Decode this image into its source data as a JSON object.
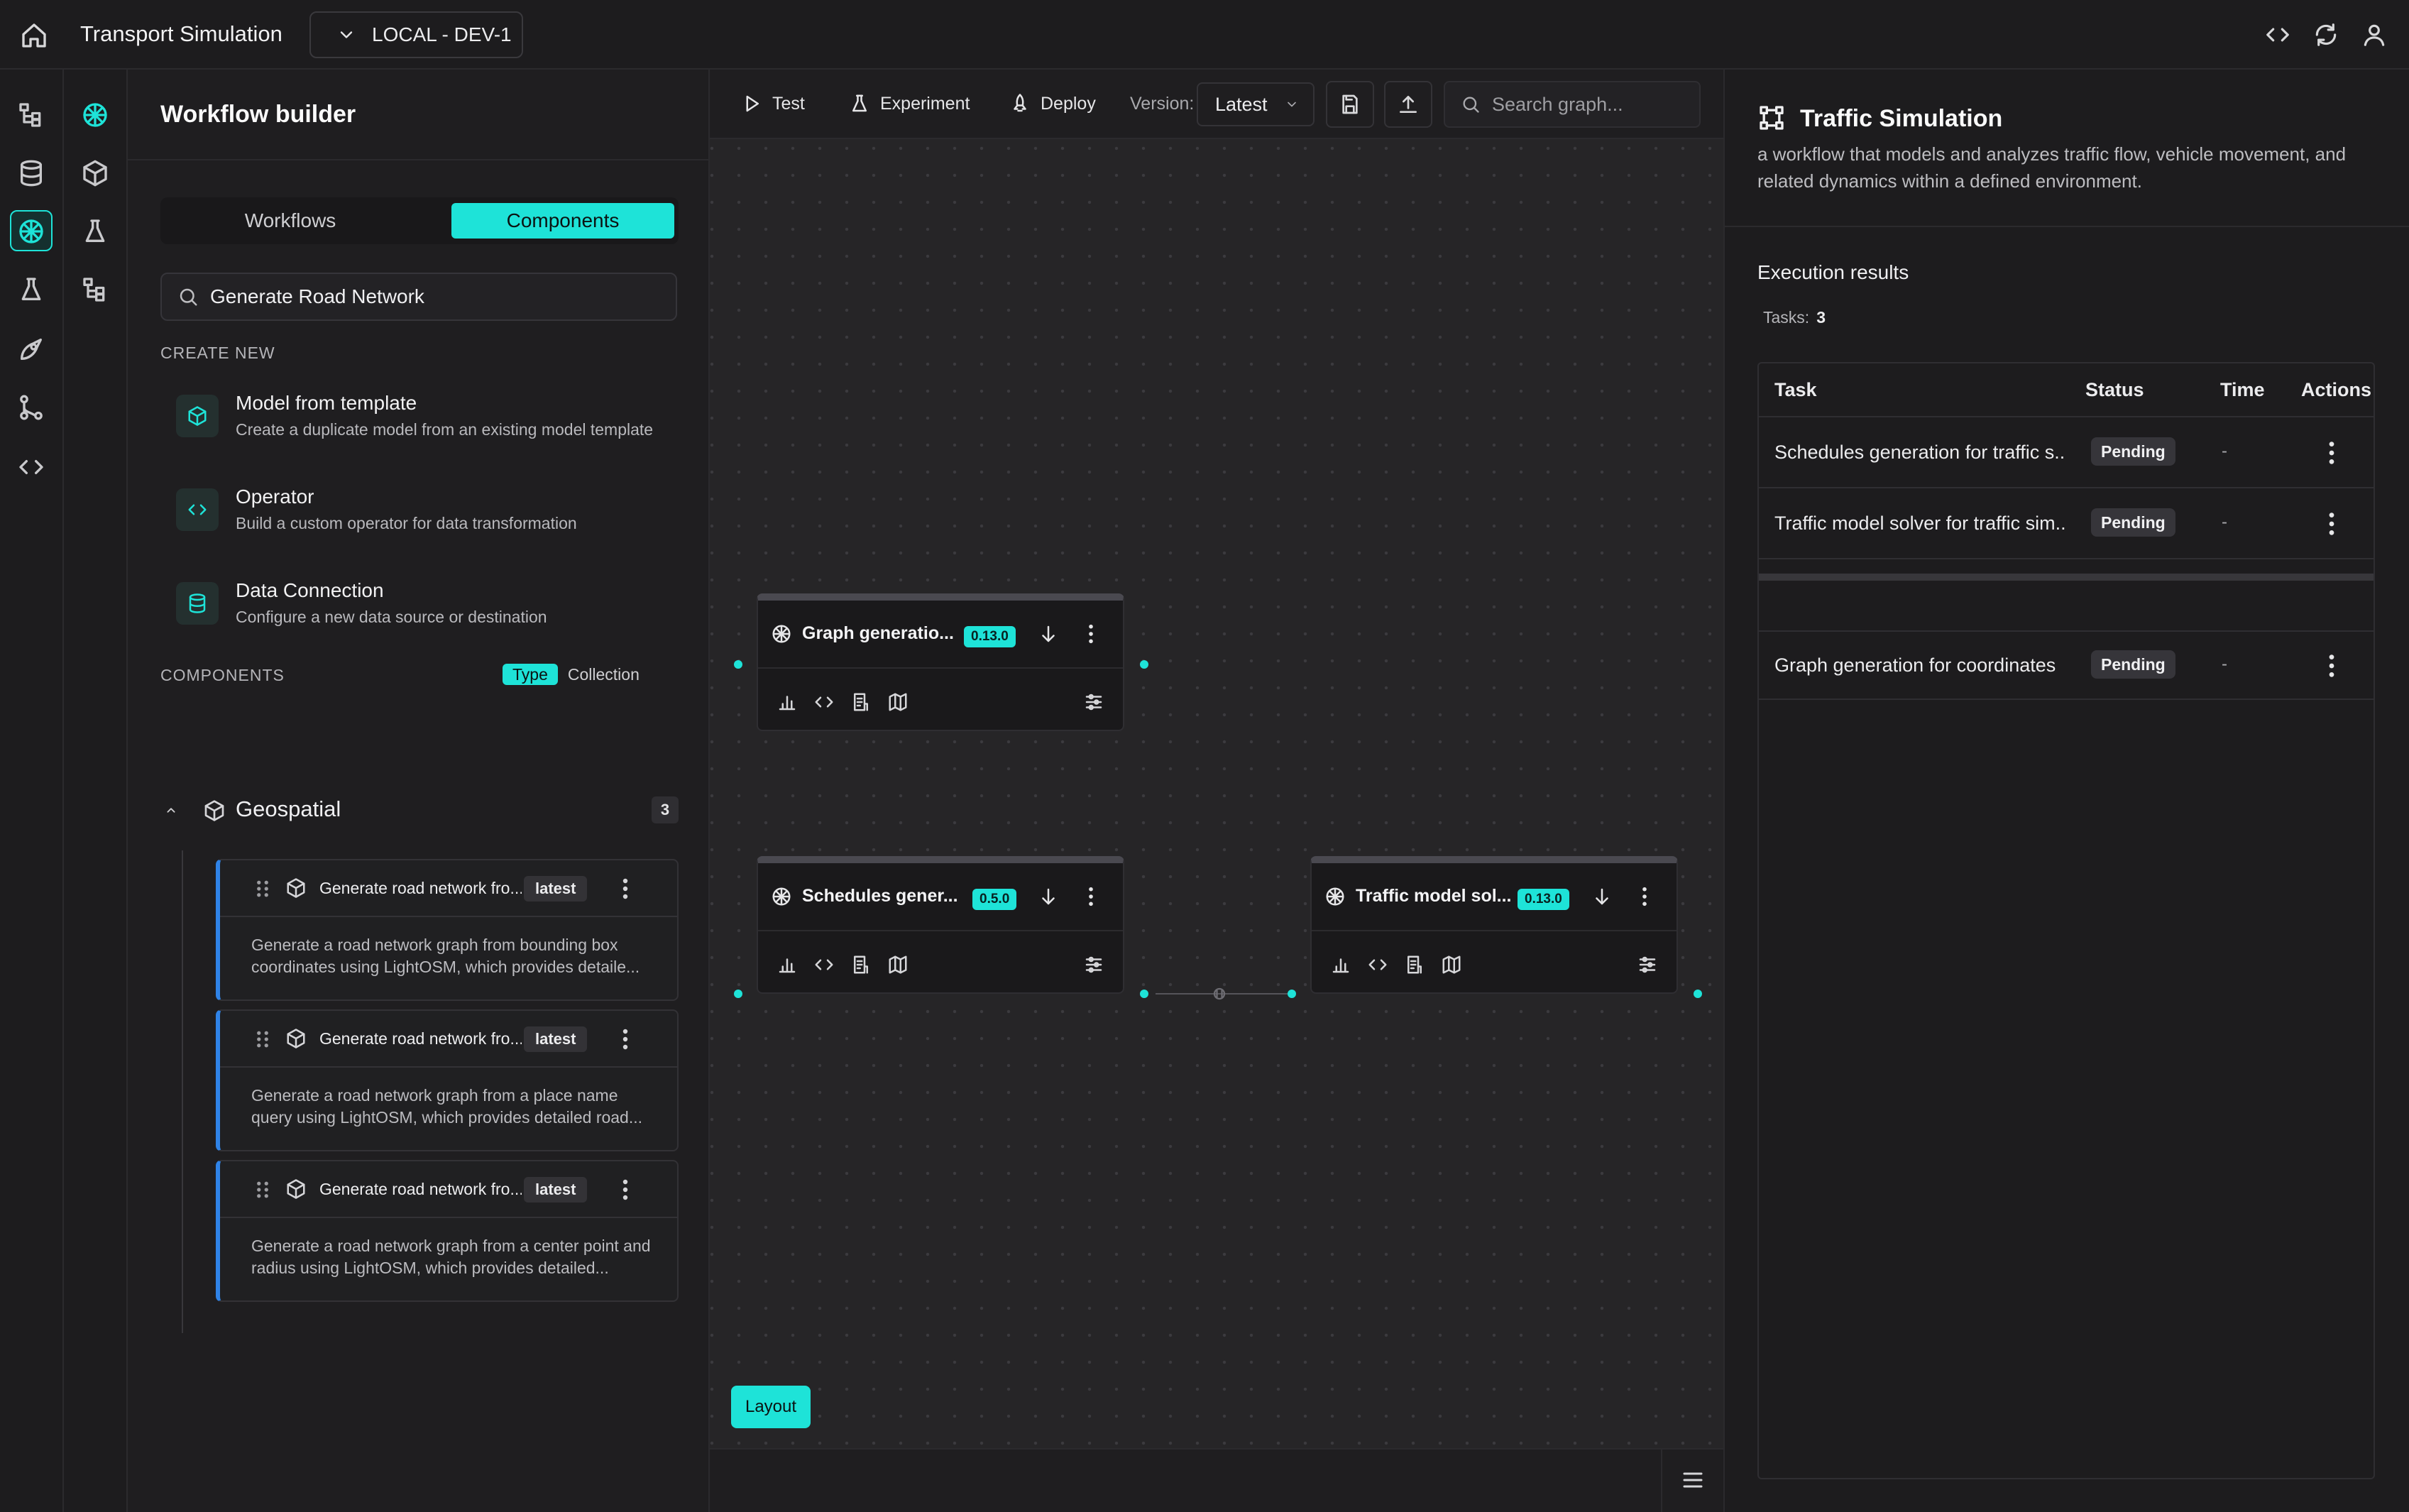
{
  "header": {
    "app_title": "Transport Simulation",
    "environment": "LOCAL - DEV-1"
  },
  "left_panel": {
    "title": "Workflow builder",
    "tabs": [
      {
        "label": "Workflows",
        "active": false
      },
      {
        "label": "Components",
        "active": true
      }
    ],
    "search_value": "Generate Road Network",
    "create_new_label": "CREATE NEW",
    "create_items": [
      {
        "title": "Model from template",
        "description": "Create a duplicate model from an existing model template",
        "icon": "cube-icon"
      },
      {
        "title": "Operator",
        "description": "Build a custom operator for data transformation",
        "icon": "code-icon"
      },
      {
        "title": "Data Connection",
        "description": "Configure a new data source or destination",
        "icon": "database-icon"
      }
    ],
    "components_label": "COMPONENTS",
    "group_by": {
      "type": "Type",
      "collection": "Collection",
      "selected": "Type"
    },
    "group": {
      "title": "Geospatial",
      "count": "3",
      "expanded": true
    },
    "components": [
      {
        "title": "Generate road network fro...",
        "badge": "latest",
        "description": "Generate a road network graph from bounding box coordinates using LightOSM, which provides detaile..."
      },
      {
        "title": "Generate road network fro...",
        "badge": "latest",
        "description": "Generate a road network graph from a place name query using LightOSM, which provides detailed road..."
      },
      {
        "title": "Generate road network fro...",
        "badge": "latest",
        "description": "Generate a road network graph from a center point and radius using LightOSM, which provides detailed..."
      }
    ]
  },
  "toolbar": {
    "test": "Test",
    "experiment": "Experiment",
    "deploy": "Deploy",
    "version_label": "Version:",
    "version_value": "Latest",
    "search_placeholder": "Search graph..."
  },
  "canvas": {
    "nodes": [
      {
        "title": "Graph generatio...",
        "version": "0.13.0"
      },
      {
        "title": "Schedules gener...",
        "version": "0.5.0"
      },
      {
        "title": "Traffic model sol...",
        "version": "0.13.0"
      }
    ],
    "layout_button": "Layout"
  },
  "right_panel": {
    "title": "Traffic Simulation",
    "description": "a workflow that models and analyzes traffic flow, vehicle movement, and related dynamics within a defined environment.",
    "results_title": "Execution results",
    "tasks_label": "Tasks:",
    "tasks_count": "3",
    "columns": [
      "Task",
      "Status",
      "Time",
      "Actions"
    ],
    "rows": [
      {
        "task": "Schedules generation for traffic s...",
        "status": "Pending",
        "time": "-"
      },
      {
        "task": "Traffic model solver for traffic sim...",
        "status": "Pending",
        "time": "-"
      },
      {
        "task": "Graph generation for coordinates",
        "status": "Pending",
        "time": "-"
      }
    ]
  },
  "colors": {
    "accent": "#1ee3d8",
    "background": "#1c1b1d",
    "card_accent": "#2f83e7"
  }
}
